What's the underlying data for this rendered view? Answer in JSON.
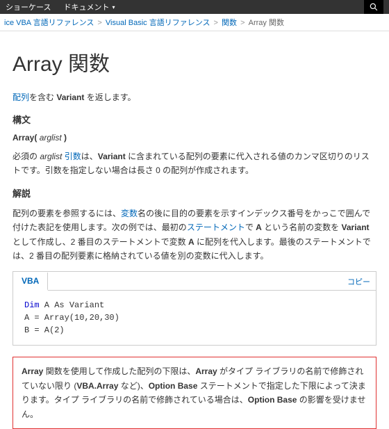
{
  "topnav": {
    "items": [
      "ショーケース",
      "ドキュメント"
    ]
  },
  "breadcrumb": {
    "items": [
      "ice VBA 言語リファレンス",
      "Visual Basic 言語リファレンス",
      "関数"
    ],
    "current": "Array 関数"
  },
  "title": "Array 関数",
  "intro": {
    "pre": "配列",
    "mid": "を含む ",
    "variant": "Variant",
    "post": " を返します。"
  },
  "sections": {
    "syntax_h": "構文",
    "syntax": {
      "fn": "Array(",
      "arg": " arglist ",
      "close": ")"
    },
    "arglist": {
      "t1": "必須の ",
      "arg": "arglist",
      "t2": " ",
      "link": "引数",
      "t3": "は、",
      "variant": "Variant",
      "t4": " に含まれている配列の要素に代入される値のカンマ区切りのリストです。引数を指定しない場合は長さ 0 の配列が作成されます。"
    },
    "desc_h": "解説",
    "desc": {
      "t1": "配列の要素を参照するには、",
      "link1": "変数",
      "t2": "名の後に目的の要素を示すインデックス番号をかっこで囲んで付けた表記を使用します。次の例では、最初の",
      "link2": "ステートメント",
      "t3": "で ",
      "a1": "A",
      "t4": " という名前の変数を ",
      "variant": "Variant",
      "t5": " として作成し、2 番目のステートメントで変数 ",
      "a2": "A",
      "t6": " に配列を代入します。最後のステートメントでは、2 番目の配列要素に格納されている値を別の変数に代入します。"
    }
  },
  "code": {
    "tab": "VBA",
    "copy": "コピー",
    "lines": [
      {
        "kw": "Dim",
        "rest": " A As Variant"
      },
      {
        "plain": "A = Array(10,20,30)"
      },
      {
        "plain": "B = A(2)"
      }
    ]
  },
  "note": {
    "b1": "Array",
    "t1": " 関数を使用して作成した配列の下限は、",
    "b2": "Array",
    "t2": " がタイプ ライブラリの名前で修飾されていない限り (",
    "b3": "VBA.Array",
    "t3": " など)、",
    "b4": "Option Base",
    "t4": " ステートメントで指定した下限によって決まります。タイプ ライブラリの名前で修飾されている場合は、",
    "b5": "Option Base",
    "t5": " の影響を受けません。"
  }
}
